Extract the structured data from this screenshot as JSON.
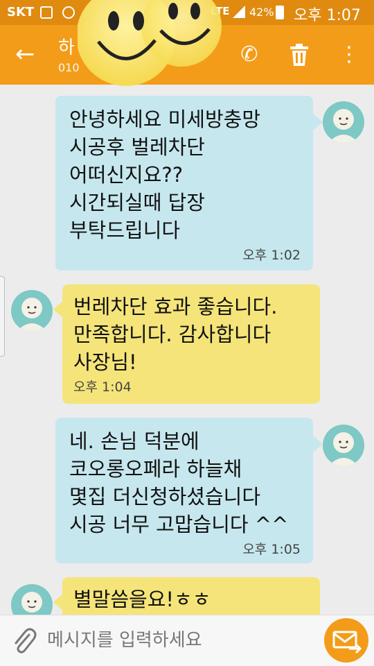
{
  "status_bar": {
    "carrier": "SKT",
    "network": "LTE",
    "battery": "42%",
    "time": "오후 1:07",
    "icons": [
      "gallery-icon",
      "cycle-icon",
      "signal-icon",
      "battery-icon"
    ]
  },
  "app_bar": {
    "contact_name": "하",
    "contact_number": "010",
    "icons": [
      "back-arrow-icon",
      "phone-icon",
      "trash-icon",
      "more-vert-icon"
    ],
    "color": "#f39c19"
  },
  "messages": [
    {
      "direction": "outgoing",
      "text": "안녕하세요  미세방충망\n시공후 벌레차단\n어떠신지요??\n시간되실때 답장\n부탁드립니다",
      "time": "오후 1:02"
    },
    {
      "direction": "incoming",
      "text": "번레차단 효과 좋습니다.\n만족합니다.  감사합니다\n사장님!",
      "time": "오후 1:04"
    },
    {
      "direction": "outgoing",
      "text": "네. 손님 덕분에\n코오롱오페라 하늘채\n몇집 더신청하셨습니다\n시공 너무 고맙습니다 ^^",
      "time": "오후 1:05"
    },
    {
      "direction": "incoming",
      "text": "별말씀을요!ㅎㅎ",
      "time": ""
    }
  ],
  "composer": {
    "placeholder": "메시지를 입력하세요",
    "icons": [
      "paperclip-icon",
      "send-mail-icon"
    ]
  },
  "colors": {
    "outgoing_bubble": "#c6e7ee",
    "incoming_bubble": "#f5e47a",
    "avatar": "#7ec8c6"
  }
}
